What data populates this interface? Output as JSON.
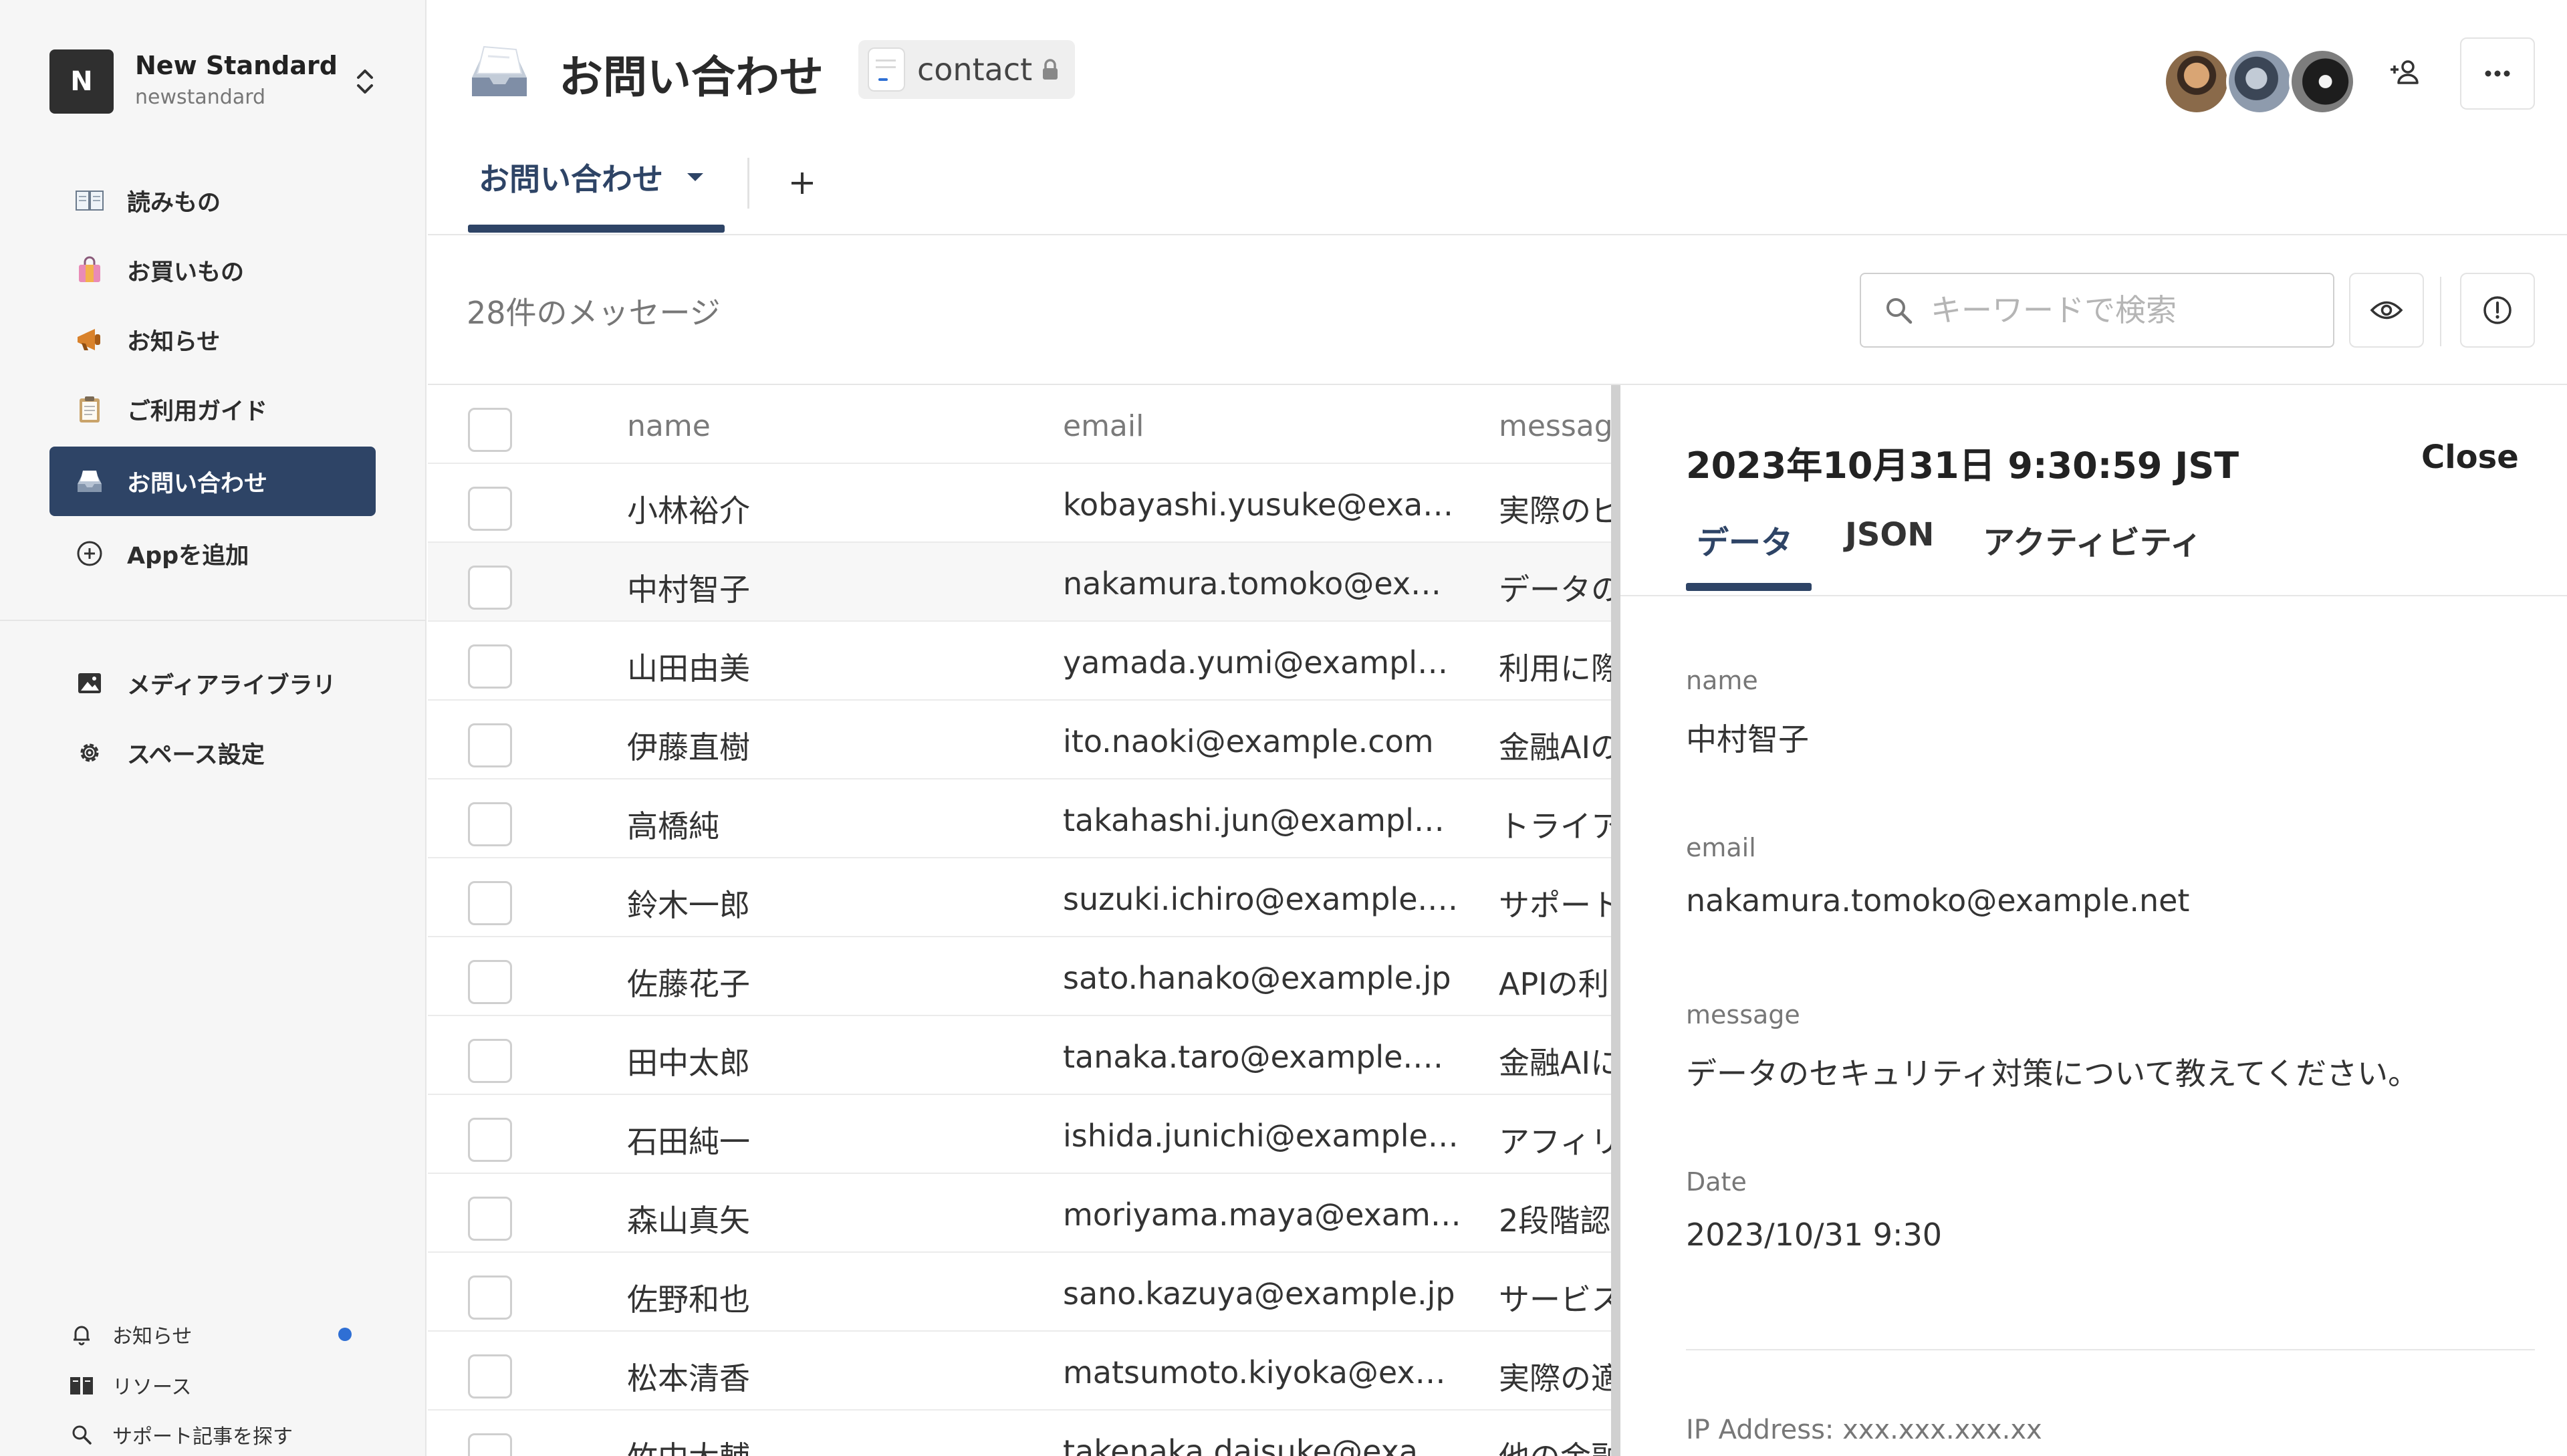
{
  "workspace": {
    "initial": "N",
    "name": "New Standard",
    "slug": "newstandard"
  },
  "sidebar": {
    "apps": [
      {
        "label": "読みもの",
        "icon": "book-icon"
      },
      {
        "label": "お買いもの",
        "icon": "shopping-bag-icon"
      },
      {
        "label": "お知らせ",
        "icon": "megaphone-icon"
      },
      {
        "label": "ご利用ガイド",
        "icon": "clipboard-icon"
      },
      {
        "label": "お問い合わせ",
        "icon": "inbox-tray-icon",
        "active": true
      }
    ],
    "add_app": "Appを追加",
    "settings_items": [
      {
        "label": "メディアライブラリ",
        "icon": "image-icon"
      },
      {
        "label": "スペース設定",
        "icon": "gear-icon"
      }
    ],
    "footer": {
      "notifications": "お知らせ",
      "resources": "リソース",
      "search_support": "サポート記事を探す"
    }
  },
  "header": {
    "title": "お問い合わせ",
    "api_name": "contact",
    "view_tab": "お問い合わせ"
  },
  "toolbar": {
    "count_text": "28件のメッセージ",
    "search_placeholder": "キーワードで検索"
  },
  "table": {
    "columns": [
      "name",
      "email",
      "messag"
    ],
    "rows": [
      {
        "name": "小林裕介",
        "email": "kobayashi.yusuke@exa…",
        "message": "実際のビ"
      },
      {
        "name": "中村智子",
        "email": "nakamura.tomoko@ex…",
        "message": "データの"
      },
      {
        "name": "山田由美",
        "email": "yamada.yumi@exampl…",
        "message": "利用に際"
      },
      {
        "name": "伊藤直樹",
        "email": "ito.naoki@example.com",
        "message": "金融AIの"
      },
      {
        "name": "高橋純",
        "email": "takahashi.jun@exampl…",
        "message": "トライア"
      },
      {
        "name": "鈴木一郎",
        "email": "suzuki.ichiro@example.…",
        "message": "サポート"
      },
      {
        "name": "佐藤花子",
        "email": "sato.hanako@example.jp",
        "message": "APIの利"
      },
      {
        "name": "田中太郎",
        "email": "tanaka.taro@example.…",
        "message": "金融AIに"
      },
      {
        "name": "石田純一",
        "email": "ishida.junichi@example…",
        "message": "アフィリ"
      },
      {
        "name": "森山真矢",
        "email": "moriyama.maya@exam…",
        "message": "2段階認"
      },
      {
        "name": "佐野和也",
        "email": "sano.kazuya@example.jp",
        "message": "サービス"
      },
      {
        "name": "松本清香",
        "email": "matsumoto.kiyoka@ex…",
        "message": "実際の適"
      },
      {
        "name": "竹中大輔",
        "email": "takenaka.daisuke@exa…",
        "message": "他の金融"
      }
    ]
  },
  "detail": {
    "title": "2023年10月31日 9:30:59 JST",
    "close_label": "Close",
    "tabs": [
      "データ",
      "JSON",
      "アクティビティ"
    ],
    "fields": [
      {
        "label": "name",
        "value": "中村智子"
      },
      {
        "label": "email",
        "value": "nakamura.tomoko@example.net"
      },
      {
        "label": "message",
        "value": "データのセキュリティ対策について教えてください。"
      },
      {
        "label": "Date",
        "value": "2023/10/31 9:30"
      }
    ],
    "ip_text": "IP Address: xxx.xxx.xxx.xx"
  },
  "colors": {
    "accent": "#2e4466",
    "notification_dot": "#2f6fd4"
  }
}
